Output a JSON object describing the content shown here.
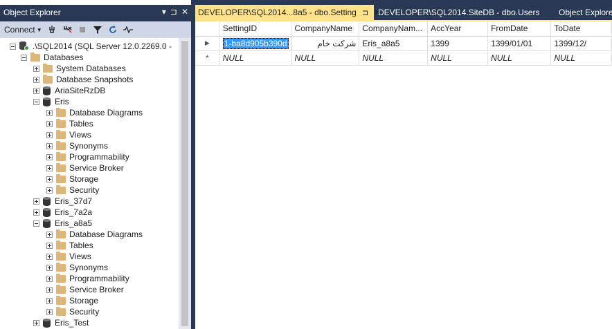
{
  "object_explorer": {
    "title": "Object Explorer",
    "title_buttons": [
      "▾",
      "⊐",
      "✕"
    ],
    "toolbar": {
      "connect_label": "Connect",
      "icons": [
        "connect-icon",
        "disconnect-icon",
        "stop-icon",
        "filter-icon",
        "refresh-icon",
        "activity-icon"
      ]
    },
    "tree": [
      {
        "level": 0,
        "type": "server",
        "expander": "minus",
        "label": ".\\SQL2014 (SQL Server 12.0.2269.0 -"
      },
      {
        "level": 1,
        "type": "folder",
        "expander": "minus",
        "label": "Databases"
      },
      {
        "level": 2,
        "type": "folder",
        "expander": "plus",
        "label": "System Databases"
      },
      {
        "level": 2,
        "type": "folder",
        "expander": "plus",
        "label": "Database Snapshots"
      },
      {
        "level": 2,
        "type": "db",
        "expander": "plus",
        "label": "AriaSiteRzDB"
      },
      {
        "level": 2,
        "type": "db",
        "expander": "minus",
        "label": "Eris"
      },
      {
        "level": 3,
        "type": "folder",
        "expander": "plus",
        "label": "Database Diagrams"
      },
      {
        "level": 3,
        "type": "folder",
        "expander": "plus",
        "label": "Tables"
      },
      {
        "level": 3,
        "type": "folder",
        "expander": "plus",
        "label": "Views"
      },
      {
        "level": 3,
        "type": "folder",
        "expander": "plus",
        "label": "Synonyms"
      },
      {
        "level": 3,
        "type": "folder",
        "expander": "plus",
        "label": "Programmability"
      },
      {
        "level": 3,
        "type": "folder",
        "expander": "plus",
        "label": "Service Broker"
      },
      {
        "level": 3,
        "type": "folder",
        "expander": "plus",
        "label": "Storage"
      },
      {
        "level": 3,
        "type": "folder",
        "expander": "plus",
        "label": "Security"
      },
      {
        "level": 2,
        "type": "db",
        "expander": "plus",
        "label": "Eris_37d7"
      },
      {
        "level": 2,
        "type": "db",
        "expander": "plus",
        "label": "Eris_7a2a"
      },
      {
        "level": 2,
        "type": "db",
        "expander": "minus",
        "label": "Eris_a8a5"
      },
      {
        "level": 3,
        "type": "folder",
        "expander": "plus",
        "label": "Database Diagrams"
      },
      {
        "level": 3,
        "type": "folder",
        "expander": "plus",
        "label": "Tables"
      },
      {
        "level": 3,
        "type": "folder",
        "expander": "plus",
        "label": "Views"
      },
      {
        "level": 3,
        "type": "folder",
        "expander": "plus",
        "label": "Synonyms"
      },
      {
        "level": 3,
        "type": "folder",
        "expander": "plus",
        "label": "Programmability"
      },
      {
        "level": 3,
        "type": "folder",
        "expander": "plus",
        "label": "Service Broker"
      },
      {
        "level": 3,
        "type": "folder",
        "expander": "plus",
        "label": "Storage"
      },
      {
        "level": 3,
        "type": "folder",
        "expander": "plus",
        "label": "Security"
      },
      {
        "level": 2,
        "type": "db",
        "expander": "plus",
        "label": "Eris_Test"
      }
    ]
  },
  "document_tabs": {
    "active_label": "DEVELOPER\\SQL2014...8a5 - dbo.Setting",
    "pin_glyph": "⊐",
    "close_glyph": "✕",
    "second_label": "DEVELOPER\\SQL2014.SiteDB - dbo.Users",
    "third_label": "Object Explorer"
  },
  "grid": {
    "columns": [
      "SettingID",
      "CompanyName",
      "CompanyNam...",
      "AccYear",
      "FromDate",
      "ToDate"
    ],
    "row_indicators": [
      "▶",
      "*"
    ],
    "rows": [
      [
        "1-ba8d905b390d",
        "شرکت خام",
        "Eris_a8a5",
        "1399",
        "1399/01/01",
        "1399/12/"
      ],
      [
        "NULL",
        "NULL",
        "NULL",
        "NULL",
        "NULL",
        "NULL"
      ]
    ]
  },
  "colors": {
    "chrome": "#293955",
    "active_tab": "#ffe28a",
    "toolbar": "#cfd6e5",
    "selection": "#3399ff"
  }
}
